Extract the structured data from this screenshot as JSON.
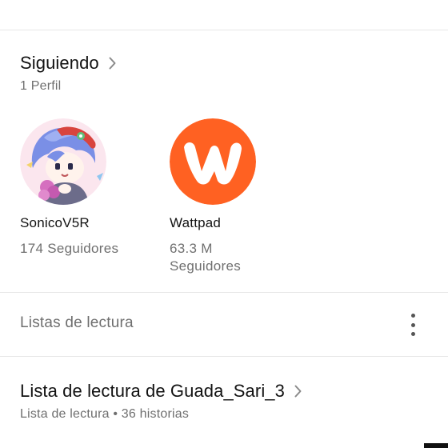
{
  "following": {
    "title": "Siguiendo",
    "count_label": "1 Perfil",
    "profiles": [
      {
        "name": "SonicoV5R",
        "followers": "174 Seguidores",
        "avatar_icon": "anime-character-avatar"
      },
      {
        "name": "Wattpad",
        "followers_line1": "63.3 M",
        "followers_line2": "Seguidores",
        "avatar_icon": "wattpad-logo-icon"
      }
    ]
  },
  "reading_lists": {
    "section_label": "Listas de lectura",
    "menu_icon": "more-vertical-icon",
    "items": [
      {
        "title": "Lista de lectura de Guada_Sari_3",
        "meta": "Lista de lectura • 36 historias"
      }
    ]
  },
  "colors": {
    "wattpad_orange": "#ff6122",
    "text_primary": "#121212",
    "text_secondary": "#6f6f6f",
    "divider": "#e7e7e7"
  }
}
